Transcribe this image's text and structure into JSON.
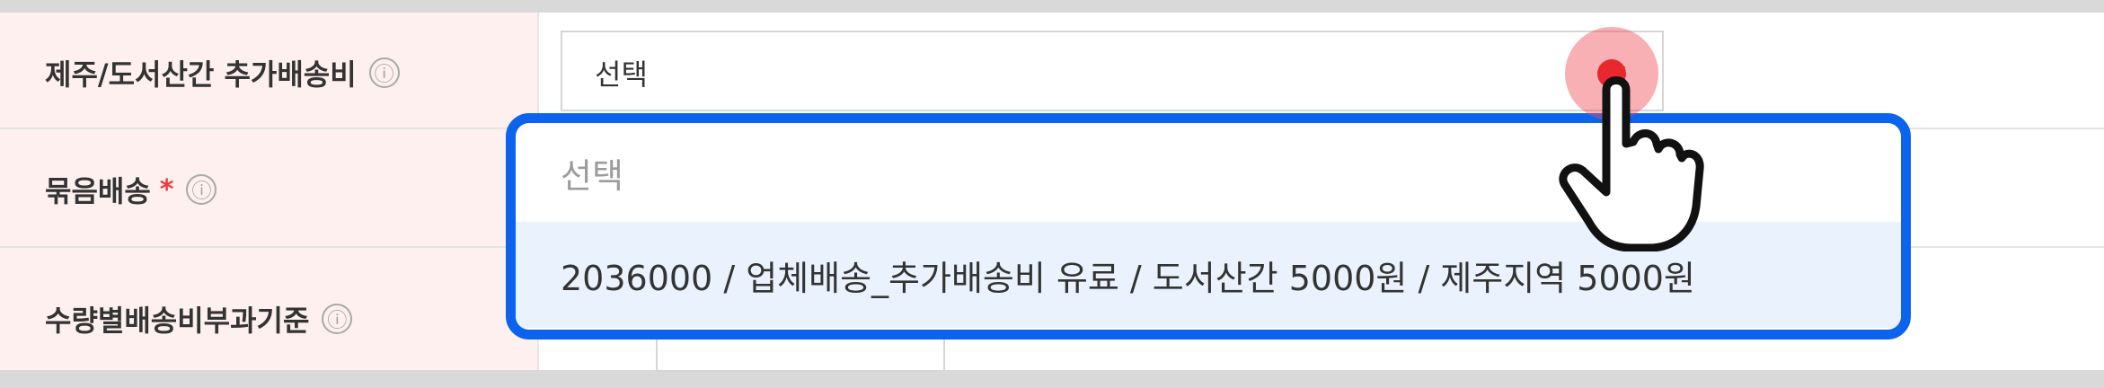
{
  "rows": [
    {
      "label": "제주/도서산간 추가배송비",
      "required": false
    },
    {
      "label": "묶음배송",
      "required": true
    },
    {
      "label": "수량별배송비부과기준",
      "required": false
    }
  ],
  "info_icon": "ⓘ",
  "required_mark": "*",
  "select": {
    "value": "선택"
  },
  "dropdown": {
    "placeholder": "선택",
    "options": [
      "2036000 / 업체배송_추가배송비 유료 / 도서산간 5000원 / 제주지역 5000원"
    ]
  },
  "colors": {
    "label_bg": "#fdf0ef",
    "dropdown_border": "#0c63ee",
    "option_hover_bg": "#e9f2fd",
    "required": "#ef3b3b",
    "click_marker": "#e8282e"
  },
  "icons": [
    "info-icon",
    "chevron-down-icon",
    "pointer-hand-icon"
  ]
}
